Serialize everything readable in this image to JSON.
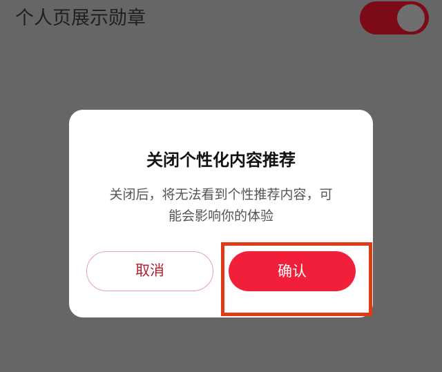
{
  "settings": {
    "badge_label": "个人页展示勋章",
    "badge_toggle": "on"
  },
  "dialog": {
    "title": "关闭个性化内容推荐",
    "message_line1": "关闭后，将无法看到个性推荐内容，可",
    "message_line2": "能会影响你的体验",
    "cancel_label": "取消",
    "confirm_label": "确认"
  },
  "colors": {
    "overlay": "#666666",
    "accent": "#f21f3b",
    "toggle_dimmed": "#7c0a17",
    "highlight": "#e03a16"
  }
}
